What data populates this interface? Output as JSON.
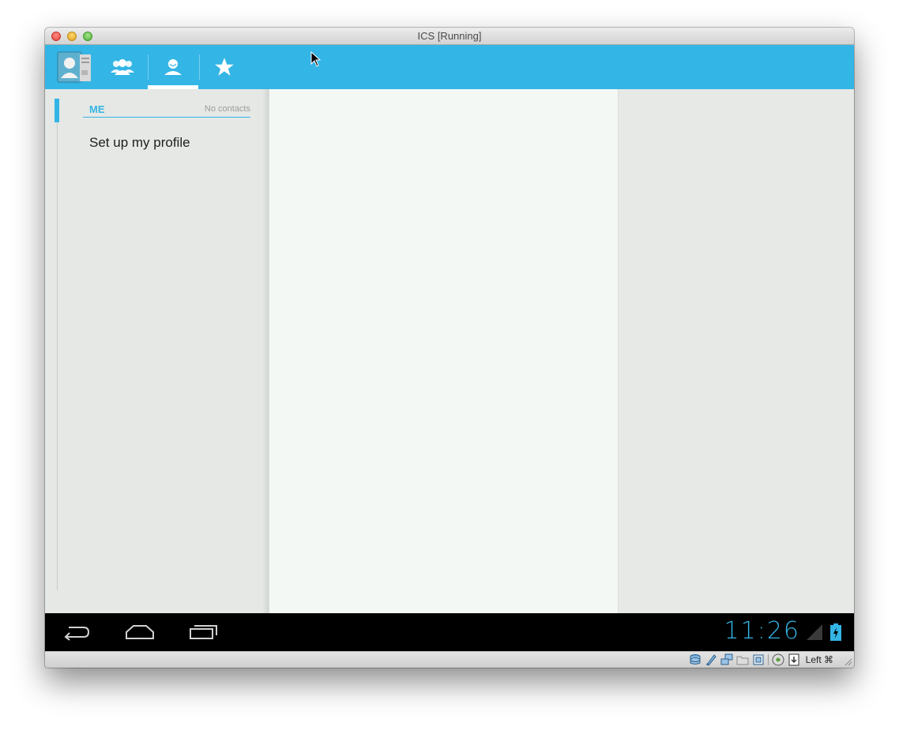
{
  "window": {
    "title": "ICS [Running]"
  },
  "action_bar": {
    "accent_color": "#33b5e5",
    "tabs": [
      {
        "name": "groups",
        "icon": "groups-icon"
      },
      {
        "name": "all-contacts",
        "icon": "person-icon",
        "selected": true
      },
      {
        "name": "favorites",
        "icon": "star-icon"
      }
    ]
  },
  "left_pane": {
    "section_title": "ME",
    "section_count": "No contacts",
    "setup_profile_label": "Set up my profile"
  },
  "navbar": {
    "time": "11:26"
  },
  "vbox_status": {
    "host_key_label": "Left ⌘",
    "icons": [
      "hard-disk-icon",
      "optical-drive-icon",
      "network-icon",
      "shared-folder-icon",
      "usb-icon",
      "capture-icon",
      "mouse-integration-icon"
    ]
  }
}
